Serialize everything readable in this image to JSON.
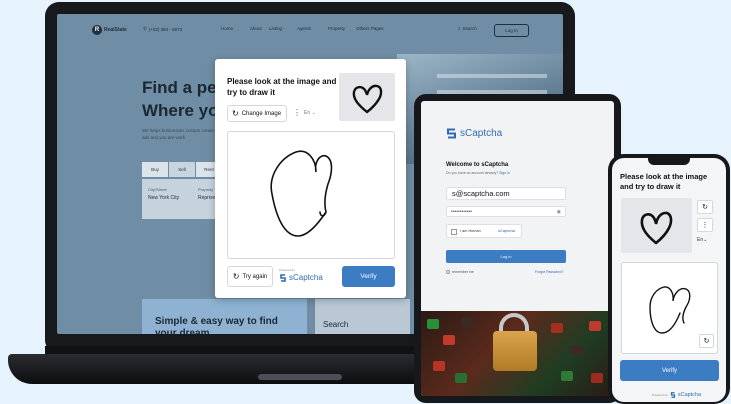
{
  "site": {
    "logo": "RealState",
    "phone": "(+02) 384 - 8673",
    "nav": [
      "Home",
      "About",
      "Listing",
      "Agents",
      "Property",
      "Others Pages"
    ],
    "search_label": "Search",
    "login_label": "Log In",
    "hero_line1": "Find a perf",
    "hero_line2": "Where you",
    "hero_sub": "We helps businesses custom create ads and you are work",
    "chips": [
      "Buy",
      "Sell",
      "Rent"
    ],
    "city_label": "City/Street",
    "city_value": "New York City",
    "property_label": "Property",
    "property_value": "Reprise",
    "band_title": "Simple & easy way to find your dream",
    "band2_label": "Search"
  },
  "captcha_modal": {
    "title": "Please look at the image and try to draw it",
    "change_image_label": "Change Image",
    "lang": "En",
    "try_again_label": "Try again",
    "powered_by": "Powered by",
    "brand": "sCaptcha",
    "verify_label": "Verify"
  },
  "tablet_login": {
    "brand": "sCaptcha",
    "welcome": "Welcome to sCaptcha",
    "sub_text": "Do you have an account already?",
    "sign_in_link": "Sign in",
    "email_value": "s@scaptcha.com",
    "password_mask": "••••••••••••",
    "human_label": "I am Human",
    "mini_brand": "sCaptcha",
    "login_label": "Log in",
    "remember_label": "remember me",
    "forgot_label": "Forgot Password?"
  },
  "phone_captcha": {
    "title": "Please look at the image and try to draw it",
    "lang": "En",
    "verify_label": "Verify",
    "powered_by": "Powered by",
    "brand": "sCaptcha"
  },
  "colors": {
    "accent": "#3c7cc2",
    "brand": "#2f6cb3",
    "page_bg": "#e7f3fc"
  }
}
